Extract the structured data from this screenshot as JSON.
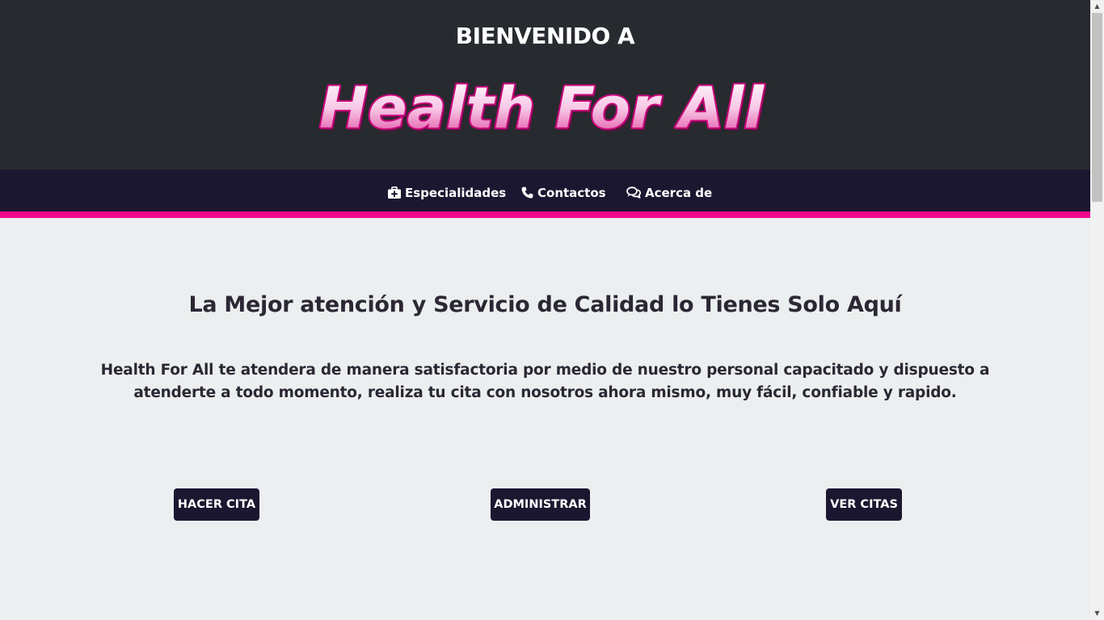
{
  "header": {
    "welcome": "BIENVENIDO A",
    "logo_text": "Health For All"
  },
  "nav": {
    "items": [
      {
        "label": "Especialidades",
        "icon": "medkit-icon"
      },
      {
        "label": "Contactos",
        "icon": "phone-icon"
      },
      {
        "label": "Acerca de",
        "icon": "comments-icon"
      }
    ]
  },
  "main": {
    "headline": "La Mejor atención y Servicio de Calidad lo Tienes Solo Aquí",
    "description": "Health For All te atendera de manera satisfactoria por medio de nuestro personal capacitado y dispuesto a atenderte a todo momento, realiza tu cita con nosotros ahora mismo, muy fácil, confiable y rapido.",
    "buttons": {
      "hacer_cita": "HACER CITA",
      "administrar": "ADMINISTRAR",
      "ver_citas": "VER CITAS"
    }
  },
  "colors": {
    "header_bg": "#272a2e",
    "nav_bg": "#1c1730",
    "accent": "#f4098c",
    "page_bg": "#eceff0",
    "text": "#2b2733"
  }
}
